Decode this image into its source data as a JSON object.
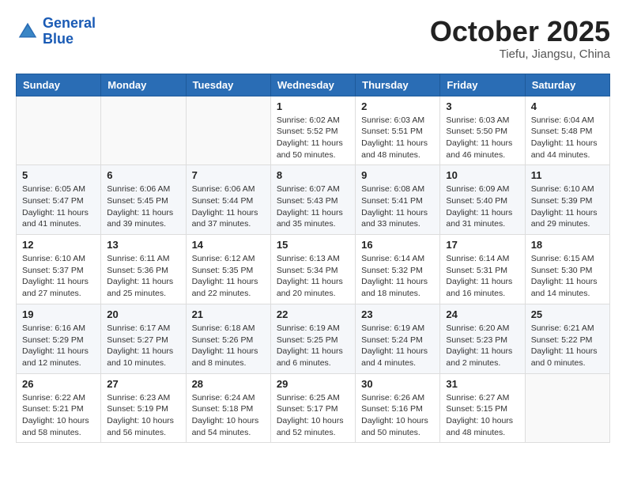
{
  "header": {
    "logo_line1": "General",
    "logo_line2": "Blue",
    "month": "October 2025",
    "location": "Tiefu, Jiangsu, China"
  },
  "weekdays": [
    "Sunday",
    "Monday",
    "Tuesday",
    "Wednesday",
    "Thursday",
    "Friday",
    "Saturday"
  ],
  "weeks": [
    [
      {
        "day": "",
        "info": ""
      },
      {
        "day": "",
        "info": ""
      },
      {
        "day": "",
        "info": ""
      },
      {
        "day": "1",
        "info": "Sunrise: 6:02 AM\nSunset: 5:52 PM\nDaylight: 11 hours\nand 50 minutes."
      },
      {
        "day": "2",
        "info": "Sunrise: 6:03 AM\nSunset: 5:51 PM\nDaylight: 11 hours\nand 48 minutes."
      },
      {
        "day": "3",
        "info": "Sunrise: 6:03 AM\nSunset: 5:50 PM\nDaylight: 11 hours\nand 46 minutes."
      },
      {
        "day": "4",
        "info": "Sunrise: 6:04 AM\nSunset: 5:48 PM\nDaylight: 11 hours\nand 44 minutes."
      }
    ],
    [
      {
        "day": "5",
        "info": "Sunrise: 6:05 AM\nSunset: 5:47 PM\nDaylight: 11 hours\nand 41 minutes."
      },
      {
        "day": "6",
        "info": "Sunrise: 6:06 AM\nSunset: 5:45 PM\nDaylight: 11 hours\nand 39 minutes."
      },
      {
        "day": "7",
        "info": "Sunrise: 6:06 AM\nSunset: 5:44 PM\nDaylight: 11 hours\nand 37 minutes."
      },
      {
        "day": "8",
        "info": "Sunrise: 6:07 AM\nSunset: 5:43 PM\nDaylight: 11 hours\nand 35 minutes."
      },
      {
        "day": "9",
        "info": "Sunrise: 6:08 AM\nSunset: 5:41 PM\nDaylight: 11 hours\nand 33 minutes."
      },
      {
        "day": "10",
        "info": "Sunrise: 6:09 AM\nSunset: 5:40 PM\nDaylight: 11 hours\nand 31 minutes."
      },
      {
        "day": "11",
        "info": "Sunrise: 6:10 AM\nSunset: 5:39 PM\nDaylight: 11 hours\nand 29 minutes."
      }
    ],
    [
      {
        "day": "12",
        "info": "Sunrise: 6:10 AM\nSunset: 5:37 PM\nDaylight: 11 hours\nand 27 minutes."
      },
      {
        "day": "13",
        "info": "Sunrise: 6:11 AM\nSunset: 5:36 PM\nDaylight: 11 hours\nand 25 minutes."
      },
      {
        "day": "14",
        "info": "Sunrise: 6:12 AM\nSunset: 5:35 PM\nDaylight: 11 hours\nand 22 minutes."
      },
      {
        "day": "15",
        "info": "Sunrise: 6:13 AM\nSunset: 5:34 PM\nDaylight: 11 hours\nand 20 minutes."
      },
      {
        "day": "16",
        "info": "Sunrise: 6:14 AM\nSunset: 5:32 PM\nDaylight: 11 hours\nand 18 minutes."
      },
      {
        "day": "17",
        "info": "Sunrise: 6:14 AM\nSunset: 5:31 PM\nDaylight: 11 hours\nand 16 minutes."
      },
      {
        "day": "18",
        "info": "Sunrise: 6:15 AM\nSunset: 5:30 PM\nDaylight: 11 hours\nand 14 minutes."
      }
    ],
    [
      {
        "day": "19",
        "info": "Sunrise: 6:16 AM\nSunset: 5:29 PM\nDaylight: 11 hours\nand 12 minutes."
      },
      {
        "day": "20",
        "info": "Sunrise: 6:17 AM\nSunset: 5:27 PM\nDaylight: 11 hours\nand 10 minutes."
      },
      {
        "day": "21",
        "info": "Sunrise: 6:18 AM\nSunset: 5:26 PM\nDaylight: 11 hours\nand 8 minutes."
      },
      {
        "day": "22",
        "info": "Sunrise: 6:19 AM\nSunset: 5:25 PM\nDaylight: 11 hours\nand 6 minutes."
      },
      {
        "day": "23",
        "info": "Sunrise: 6:19 AM\nSunset: 5:24 PM\nDaylight: 11 hours\nand 4 minutes."
      },
      {
        "day": "24",
        "info": "Sunrise: 6:20 AM\nSunset: 5:23 PM\nDaylight: 11 hours\nand 2 minutes."
      },
      {
        "day": "25",
        "info": "Sunrise: 6:21 AM\nSunset: 5:22 PM\nDaylight: 11 hours\nand 0 minutes."
      }
    ],
    [
      {
        "day": "26",
        "info": "Sunrise: 6:22 AM\nSunset: 5:21 PM\nDaylight: 10 hours\nand 58 minutes."
      },
      {
        "day": "27",
        "info": "Sunrise: 6:23 AM\nSunset: 5:19 PM\nDaylight: 10 hours\nand 56 minutes."
      },
      {
        "day": "28",
        "info": "Sunrise: 6:24 AM\nSunset: 5:18 PM\nDaylight: 10 hours\nand 54 minutes."
      },
      {
        "day": "29",
        "info": "Sunrise: 6:25 AM\nSunset: 5:17 PM\nDaylight: 10 hours\nand 52 minutes."
      },
      {
        "day": "30",
        "info": "Sunrise: 6:26 AM\nSunset: 5:16 PM\nDaylight: 10 hours\nand 50 minutes."
      },
      {
        "day": "31",
        "info": "Sunrise: 6:27 AM\nSunset: 5:15 PM\nDaylight: 10 hours\nand 48 minutes."
      },
      {
        "day": "",
        "info": ""
      }
    ]
  ]
}
